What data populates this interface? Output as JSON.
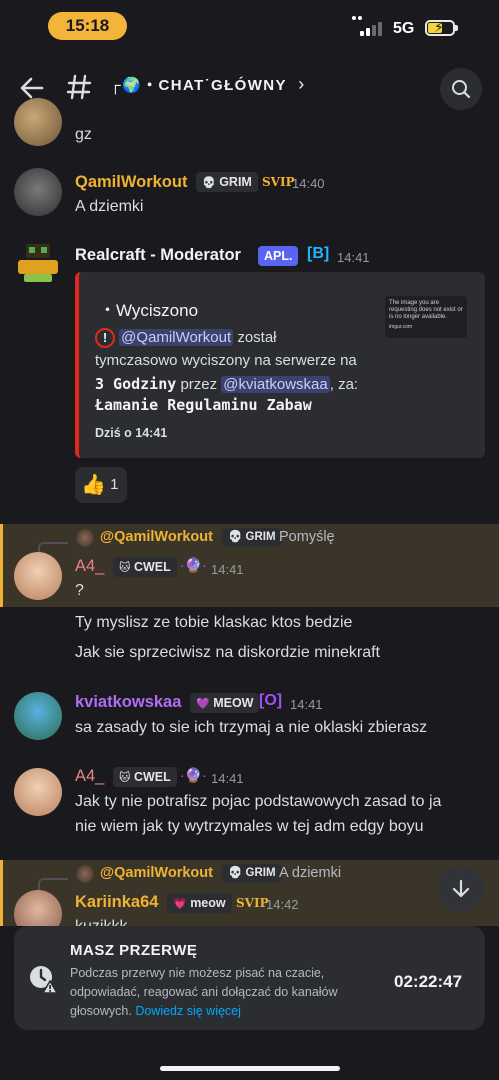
{
  "status_bar": {
    "time": "15:18",
    "network": "5G",
    "battery_icon": "battery-charging-icon"
  },
  "header": {
    "channel_icon": "hash-icon",
    "title": "┌🌍・CHAT˙GŁÓWNY",
    "chevron": "›"
  },
  "messages": [
    {
      "text": "gz"
    },
    {
      "user": "QamilWorkout",
      "user_color": "#f0b232",
      "badge": "GRIM",
      "badge_icon": "💀",
      "rank": "SVIP",
      "time": "14:40",
      "text": "A dziemki"
    },
    {
      "user": "Realcraft - Moderator",
      "user_color": "#f2f3f5",
      "app_tag": "APL.",
      "extra_tag": "[B]",
      "time": "14:41",
      "embed": {
        "title": "・Wyciszono",
        "mention_user": "@QamilWorkout",
        "line1_suffix": " został",
        "line2": "tymczasowo wyciszony na serwerze na",
        "duration": "3 Godziny",
        "by_text": " przez ",
        "mention_mod": "@kviatkowskaa",
        "reason_prefix": ", za:",
        "reason": "Łamanie Regulaminu Zabaw",
        "footer": "Dziś o 14:41",
        "thumb_text": "The image you are requesting does not exist or is no longer available.",
        "thumb_source": "imgur.com"
      },
      "reaction": {
        "emoji": "👍",
        "count": "1"
      }
    },
    {
      "reply": {
        "user": "@QamilWorkout",
        "badge": "GRIM",
        "text": "Pomyślę"
      },
      "user": "A4_",
      "user_color": "#e8838a",
      "badge": "CWEL",
      "badge_icon": "🐱",
      "time": "14:41",
      "lines": [
        "?",
        "Ty myslisz ze tobie klaskac ktos bedzie",
        "Jak sie sprzeciwisz na diskordzie minekraft"
      ]
    },
    {
      "user": "kviatkowskaa",
      "user_color": "#b36cf5",
      "badge": "MEOW",
      "badge_icon": "💜",
      "extra_tag": "[O]",
      "time": "14:41",
      "text": "sa zasady to sie ich trzymaj a nie oklaski zbierasz"
    },
    {
      "user": "A4_",
      "user_color": "#e8838a",
      "badge": "CWEL",
      "badge_icon": "🐱",
      "time": "14:41",
      "lines": [
        "Jak ty nie potrafisz pojac podstawowych zasad to ja",
        "nie wiem jak ty wytrzymales w tej adm edgy boyu"
      ]
    },
    {
      "reply": {
        "user": "@QamilWorkout",
        "badge": "GRIM",
        "text": "A dziemki"
      },
      "user": "Kariinka64",
      "user_color": "#f0b232",
      "badge": "meow",
      "badge_icon": "💗",
      "rank": "SVIP",
      "time": "14:42",
      "text": "kuzikkk"
    }
  ],
  "break_notice": {
    "title": "MASZ PRZERWĘ",
    "line1": "Podczas przerwy nie możesz pisać na czacie,",
    "line2": "odpowiadać, reagować ani dołączać do kanałów",
    "line3_prefix": "głosowych. ",
    "link": "Dowiedz się więcej",
    "timer": "02:22:47",
    "icon": "clock-warning-icon"
  },
  "colors": {
    "background": "#1a1a1e",
    "embed_accent": "#e0281e",
    "mention_bg": "#3c4270",
    "highlight_bar": "#f0b232",
    "link": "#00a8fc"
  }
}
